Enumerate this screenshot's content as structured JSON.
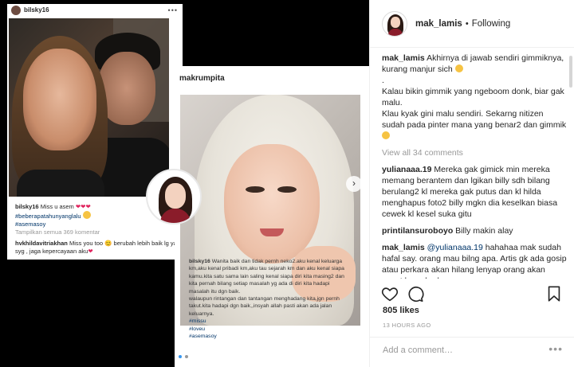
{
  "screenshot": {
    "card1": {
      "username": "bilsky16",
      "caption_user": "bilsky16",
      "caption_text": "Miss u asem",
      "hashtag1": "#beberapatahunyanglalu",
      "hashtag2": "#asemasoy",
      "view_comments": "Tampilkan semua 369 komentar",
      "reply_user": "hvkhildavitriakhan",
      "reply_text": "Miss you too 😊 berubah lebih baik lg ya syg , jaga kepercayaan aku"
    },
    "card2": {
      "username": "makrumpita",
      "caption_user": "bilsky16",
      "caption_text": "Wanita baik dan tidak pernh neko2.aku kenal keluarga km,aku kenal pribadi km,aku tau sejarah km dan aku kenal siapa kamu.kita satu sama lain saling kenal siapa diri kita masing2 dan kita pernah bilang setiap masalah yg ada di diri kita hadapi masalah itu dgn baik.",
      "caption_text2": "walaupun rintangan dan tantangan menghadang kita,jgn pernh takut.kita hadapi dgn baik,,insyah allah pasti akan ada jalan keluarnya.",
      "tags": [
        "#missu",
        "#loveu",
        "#asemasoy"
      ]
    }
  },
  "header": {
    "username": "mak_lamis",
    "separator": "•",
    "follow_status": "Following"
  },
  "comments": {
    "caption": {
      "user": "mak_lamis",
      "line1": "Akhirnya di jawab sendiri gimmiknya, kurang manjur sich",
      "dot": ".",
      "line2": "Kalau bikin gimmik yang ngeboom donk, biar gak malu.",
      "line3": "Klau kyak gini malu sendiri. Sekarng nitizen sudah pada pinter mana yang benar2 dan gimmik"
    },
    "view_all": "View all 34 comments",
    "items": [
      {
        "user": "yulianaaa.19",
        "text": "Mereka gak gimick min mereka memang berantem dan lgikan billy sdh bilang berulang2 kl mereka gak putus dan kl hilda menghapus foto2 billy mgkn dia keselkan biasa cewek kl kesel suka gitu"
      },
      {
        "user": "printilansuroboyo",
        "text": "Billy makin alay"
      },
      {
        "user": "mak_lamis",
        "mention": "@yulianaaa.19",
        "text": "hahahaa mak sudah hafal say. orang mau bilng apa. Artis gk ada gosip atau perkara akan hilang lenyap orang akan cepat lupa. beda sama"
      }
    ]
  },
  "actions": {
    "likes": "805 likes",
    "time": "13 HOURS AGO",
    "add_comment_placeholder": "Add a comment…",
    "more": "•••"
  },
  "colors": {
    "accent_blue": "#3897f0",
    "link": "#003569",
    "muted": "#999999",
    "heart": "#e0245e"
  }
}
